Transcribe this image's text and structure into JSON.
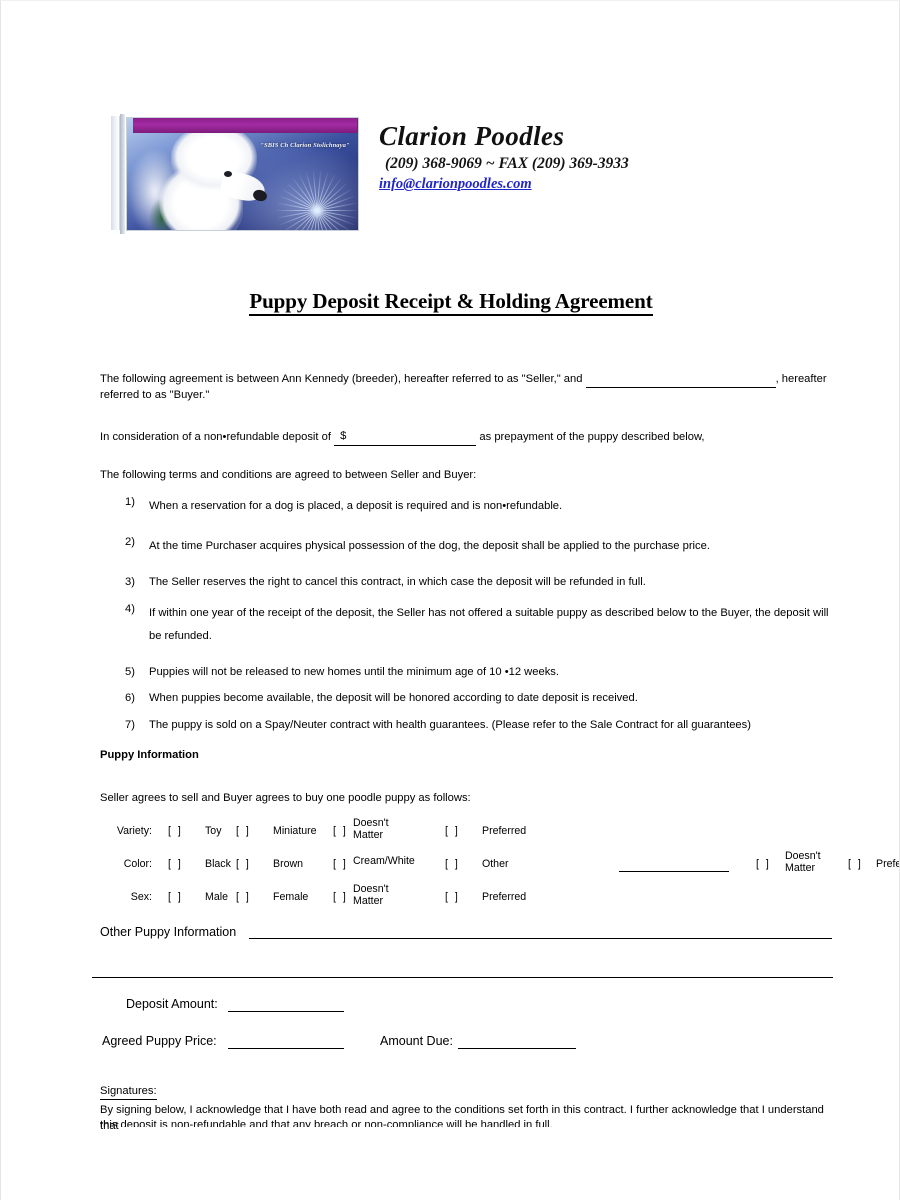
{
  "letterhead": {
    "logo_caption": "\"SBIS Ch Clarion Stolichnaya\"",
    "brand_name": "Clarion Poodles",
    "phone_line": "(209) 368-9069 ~ FAX (209) 369-3933",
    "email": "info@clarionpoodles.com",
    "accent_purple": "#8c1f8c",
    "link_blue": "#2026c8"
  },
  "title": "Puppy Deposit Receipt & Holding Agreement",
  "intro": {
    "p1_before": "The following agreement is between Ann Kennedy (breeder), hereafter referred to as \"Seller,\" and ",
    "p1_after": ", hereafter referred to as \"Buyer.\"",
    "p2_before": "In consideration of a non•refundable deposit of ",
    "p2_dollar": "$",
    "p2_after": " as prepayment of the puppy described below,",
    "p3": "The following terms and conditions are agreed to between Seller and Buyer:"
  },
  "terms": [
    {
      "num": "1)",
      "text": "When a reservation for a dog is placed, a deposit is required and is non•refundable."
    },
    {
      "num": "2)",
      "text": "At the time Purchaser acquires physical possession of the dog, the deposit shall be applied to the purchase price."
    },
    {
      "num": "3)",
      "text": "The Seller reserves the right to cancel this contract, in which case the deposit will be refunded in full."
    },
    {
      "num": "4)",
      "text": "If within one year of the receipt of the deposit, the Seller has not offered a suitable puppy as described below to the Buyer, the deposit will be refunded."
    },
    {
      "num": "5)",
      "text": "Puppies will not be released to new homes until the minimum age of 10 •12 weeks."
    },
    {
      "num": "6)",
      "text": "When puppies become available, the deposit will be honored according to date deposit is received."
    },
    {
      "num": "7)",
      "text": "The puppy is sold on a Spay/Neuter contract with health guarantees. (Please refer to the Sale Contract for all guarantees)"
    }
  ],
  "puppy_info": {
    "heading": "Puppy Information",
    "lead": "Seller agrees to sell and Buyer agrees to buy one poodle puppy as follows:",
    "checkbox_glyph": "[  ]",
    "rows": [
      {
        "label": "Variety:",
        "options": [
          "Toy",
          "Miniature",
          "Doesn't Matter",
          "Preferred"
        ]
      },
      {
        "label": "Color:",
        "options": [
          "Black",
          "Brown",
          "Cream/White",
          "Other",
          "Doesn't Matter",
          "Preferred"
        ]
      },
      {
        "label": "Sex:",
        "options": [
          "Male",
          "Female",
          "Doesn't Matter",
          "Preferred"
        ]
      }
    ]
  },
  "other_info_label": "Other Puppy Information",
  "amounts": {
    "deposit_label": "Deposit Amount:",
    "agreed_price_label": "Agreed Puppy Price:",
    "amount_due_label": "Amount Due:"
  },
  "signatures": {
    "heading": "Signatures:",
    "body": "By signing below, I acknowledge that I have both read and agree to the conditions set forth in this contract. I further acknowledge that I understand that",
    "body_clipped": "this deposit is non-refundable and that any breach or non-compliance will be handled in full."
  }
}
